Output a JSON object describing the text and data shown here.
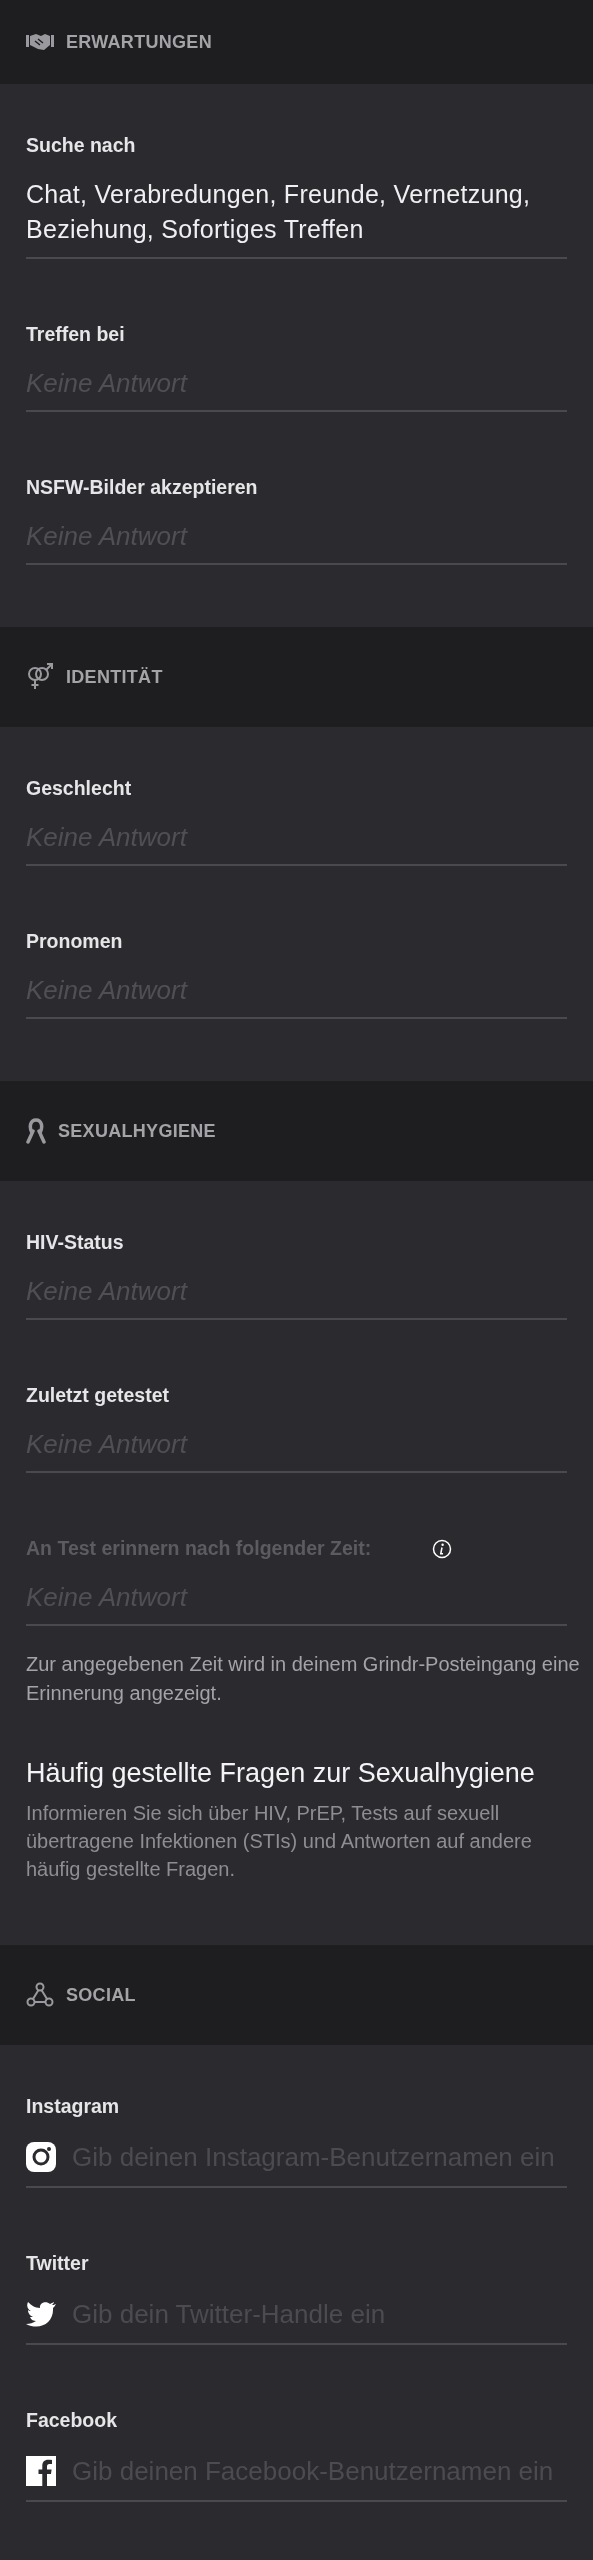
{
  "sections": [
    {
      "title": "ERWARTUNGEN",
      "fields": [
        {
          "label": "Suche nach",
          "value": "Chat, Verabredungen, Freunde, Vernetzung, Beziehung, Sofortiges Treffen",
          "disabled": false,
          "info": false
        },
        {
          "label": "Treffen bei",
          "placeholder": "Keine Antwort",
          "disabled": false,
          "info": false
        },
        {
          "label": "NSFW-Bilder akzeptieren",
          "placeholder": "Keine Antwort",
          "disabled": false,
          "info": false
        }
      ]
    },
    {
      "title": "IDENTITÄT",
      "fields": [
        {
          "label": "Geschlecht",
          "placeholder": "Keine Antwort",
          "disabled": false,
          "info": false
        },
        {
          "label": "Pronomen",
          "placeholder": "Keine Antwort",
          "disabled": false,
          "info": false
        }
      ]
    },
    {
      "title": "SEXUALHYGIENE",
      "fields": [
        {
          "label": "HIV-Status",
          "placeholder": "Keine Antwort",
          "disabled": false,
          "info": false
        },
        {
          "label": "Zuletzt getestet",
          "placeholder": "Keine Antwort",
          "disabled": false,
          "info": false
        },
        {
          "label": "An Test erinnern nach folgender Zeit:",
          "placeholder": "Keine Antwort",
          "disabled": true,
          "info": true,
          "note": "Zur angegebenen Zeit wird in deinem Grindr-Posteingang eine Erinnerung angezeigt."
        }
      ],
      "faq": {
        "title": "Häufig gestellte Fragen zur Sexualhygiene",
        "text": "Informieren Sie sich über HIV, PrEP, Tests auf sexuell übertragene Infektionen (STIs) und Antworten auf andere häufig gestellte Fragen."
      }
    },
    {
      "title": "SOCIAL",
      "fields": [
        {
          "label": "Instagram",
          "placeholder": "Gib deinen Instagram-Benutzernamen ein",
          "disabled": false,
          "info": false
        },
        {
          "label": "Twitter",
          "placeholder": "Gib dein Twitter-Handle ein",
          "disabled": false,
          "info": false
        },
        {
          "label": "Facebook",
          "placeholder": "Gib deinen Facebook-Benutzernamen ein",
          "disabled": false,
          "info": false
        }
      ]
    }
  ]
}
